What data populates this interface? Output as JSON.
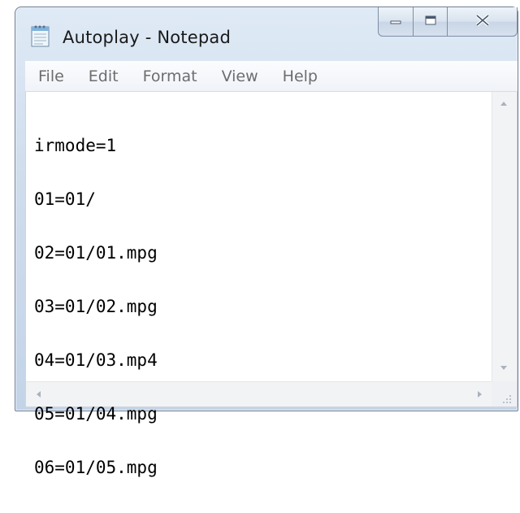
{
  "window": {
    "title": "Autoplay - Notepad"
  },
  "menubar": {
    "items": [
      {
        "label": "File"
      },
      {
        "label": "Edit"
      },
      {
        "label": "Format"
      },
      {
        "label": "View"
      },
      {
        "label": "Help"
      }
    ]
  },
  "editor": {
    "lines": [
      "irmode=1",
      "01=01/",
      "02=01/01.mpg",
      "03=01/02.mpg",
      "04=01/03.mp4",
      "05=01/04.mpg",
      "06=01/05.mpg"
    ]
  },
  "icons": {
    "app": "notepad-icon",
    "minimize": "minimize-icon",
    "maximize": "maximize-icon",
    "close": "close-icon"
  }
}
